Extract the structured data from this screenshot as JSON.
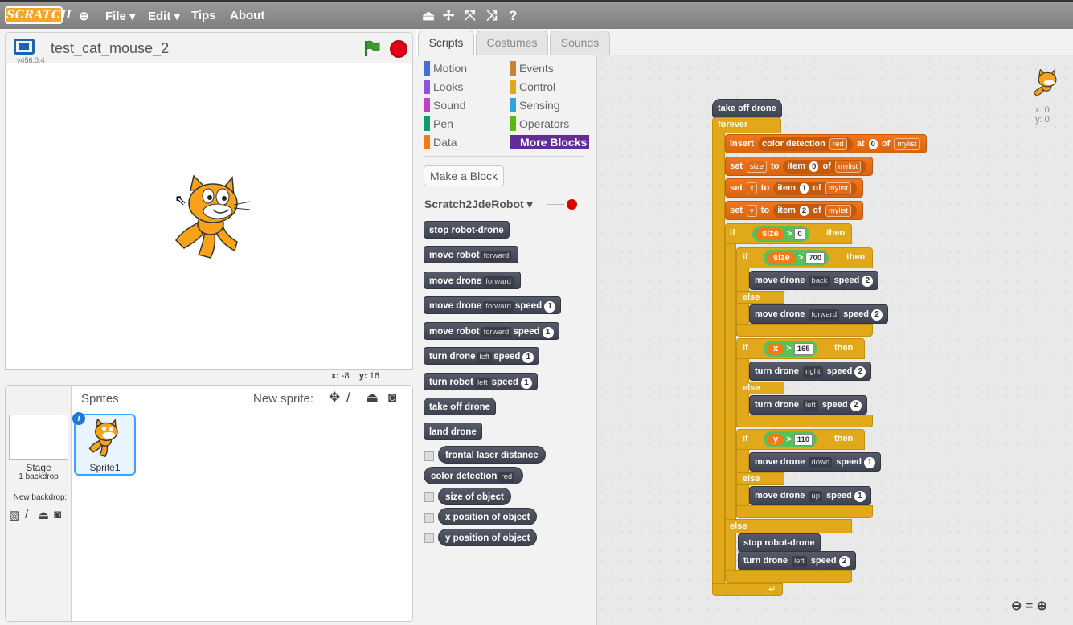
{
  "menubar": {
    "logo": "SCRATCH",
    "file": "File ▾",
    "edit": "Edit ▾",
    "tips": "Tips",
    "about": "About"
  },
  "stage": {
    "title": "test_cat_mouse_2",
    "version": "v456.0.4",
    "coords_x_label": "x:",
    "coords_x": "-8",
    "coords_y_label": "y:",
    "coords_y": "16"
  },
  "sprites": {
    "title": "Sprites",
    "new_sprite": "New sprite:",
    "stage_label": "Stage",
    "stage_backdrops": "1 backdrop",
    "new_backdrop": "New backdrop:",
    "sprite1": "Sprite1"
  },
  "tabs": {
    "scripts": "Scripts",
    "costumes": "Costumes",
    "sounds": "Sounds"
  },
  "categories": {
    "motion": "Motion",
    "looks": "Looks",
    "sound": "Sound",
    "pen": "Pen",
    "data": "Data",
    "events": "Events",
    "control": "Control",
    "sensing": "Sensing",
    "operators": "Operators",
    "more": "More Blocks"
  },
  "palette": {
    "make_block": "Make a Block",
    "extension": "Scratch2JdeRobot ▾",
    "blocks": [
      "stop robot-drone",
      "move robot",
      "move drone",
      "move drone",
      "move robot",
      "turn drone",
      "turn robot",
      "take off drone",
      "land drone",
      "frontal laser distance",
      "color detection",
      "size of object",
      "x position of object",
      "y position of object"
    ],
    "forward": "forward",
    "left": "left",
    "red": "red",
    "speed": "speed",
    "one": "1"
  },
  "script": {
    "hat": "take off drone",
    "forever": "forever",
    "insert": "insert",
    "color_detection": "color detection",
    "red": "red",
    "at": "at",
    "zero": "0",
    "of": "of",
    "mylist": "mylist",
    "set": "set",
    "size": "size",
    "to": "to",
    "item": "item",
    "one": "1",
    "two": "2",
    "x": "x",
    "y": "y",
    "if": "if",
    "then": "then",
    "else": "else",
    "gt": ">",
    "seven_hundred": "700",
    "one_sixty_five": "165",
    "one_ten": "110",
    "move_drone": "move drone",
    "turn_drone": "turn drone",
    "back": "back",
    "forward": "forward",
    "right": "right",
    "left": "left",
    "down": "down",
    "up": "up",
    "speed": "speed",
    "stop": "stop robot-drone",
    "sprite_x": "x: 0",
    "sprite_y": "y: 0"
  },
  "colors": {
    "motion": "#4a6cd4",
    "looks": "#8a55d7",
    "sound": "#bb42c3",
    "pen": "#0e9a6c",
    "data": "#ee7d16",
    "events": "#c88330",
    "control": "#e1a91a",
    "sensing": "#2ca5e2",
    "operators": "#5cb712",
    "more": "#632d99"
  }
}
